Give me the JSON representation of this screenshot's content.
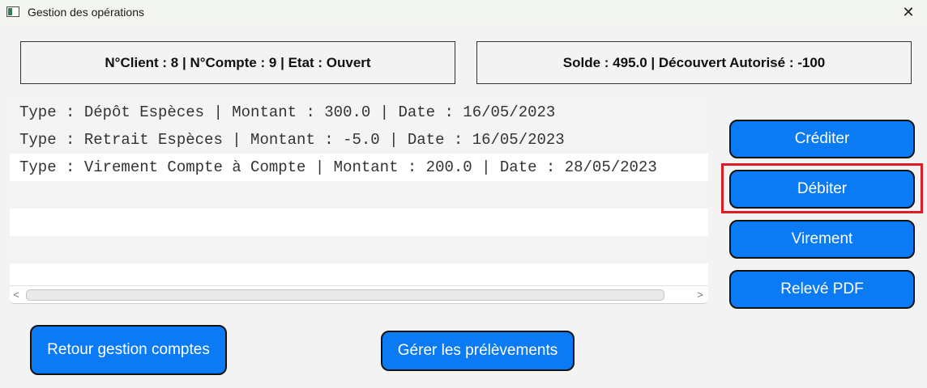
{
  "window": {
    "title": "Gestion des opérations",
    "close_glyph": "✕"
  },
  "info": {
    "left": "N°Client : 8 | N°Compte : 9 | Etat : Ouvert",
    "right": "Solde : 495.0 | Découvert Autorisé : -100"
  },
  "operations": [
    "Type : Dépôt Espèces  |  Montant : 300.0  |  Date : 16/05/2023",
    "Type : Retrait Espèces  |  Montant : -5.0  |  Date : 16/05/2023",
    "Type : Virement Compte à Compte  |  Montant : 200.0  |  Date : 28/05/2023",
    "",
    "",
    ""
  ],
  "scroll": {
    "left_arrow": "<",
    "right_arrow": ">"
  },
  "buttons": {
    "crediter": "Créditer",
    "debiter": "Débiter",
    "virement": "Virement",
    "releve": "Relevé PDF",
    "retour": "Retour gestion comptes",
    "prelevements": "Gérer les prélèvements"
  },
  "colors": {
    "button_blue": "#0a7af5",
    "highlight_red": "#e01b24"
  },
  "icons": {
    "app": "app-window-icon",
    "close": "close-icon"
  }
}
